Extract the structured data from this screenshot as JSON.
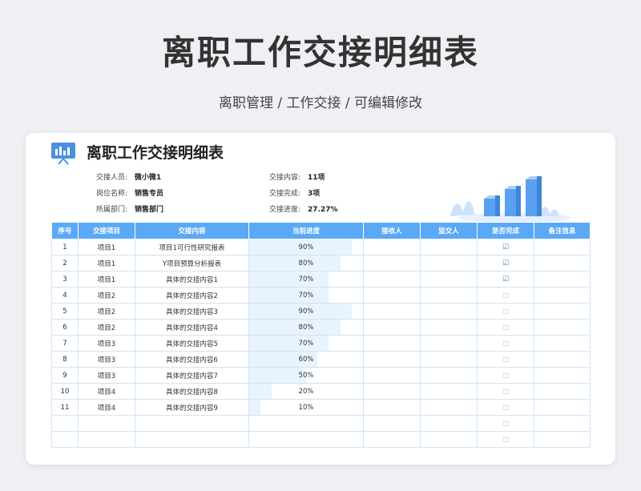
{
  "page": {
    "title": "离职工作交接明细表",
    "subtitle": "离职管理 / 工作交接 / 可编辑修改"
  },
  "doc": {
    "title": "离职工作交接明细表",
    "info_left": [
      {
        "label": "交接人员:",
        "value": "微小微1"
      },
      {
        "label": "岗位名称:",
        "value": "销售专员"
      },
      {
        "label": "所属部门:",
        "value": "销售部门"
      }
    ],
    "info_right": [
      {
        "label": "交接内容:",
        "value": "11项"
      },
      {
        "label": "交接完成:",
        "value": "3项"
      },
      {
        "label": "交接进度:",
        "value": "27.27%"
      }
    ]
  },
  "table": {
    "headers": [
      "序号",
      "交接项目",
      "交接内容",
      "当前进度",
      "接收人",
      "监交人",
      "是否完成",
      "备注信息"
    ],
    "rows": [
      {
        "no": "1",
        "item": "项目1",
        "content": "项目1可行性研究报表",
        "progress": "90%",
        "progress_value": 90,
        "done": true
      },
      {
        "no": "2",
        "item": "项目1",
        "content": "Y项目预算分析报表",
        "progress": "80%",
        "progress_value": 80,
        "done": true
      },
      {
        "no": "3",
        "item": "项目1",
        "content": "具体的交接内容1",
        "progress": "70%",
        "progress_value": 70,
        "done": true
      },
      {
        "no": "4",
        "item": "项目2",
        "content": "具体的交接内容2",
        "progress": "70%",
        "progress_value": 70,
        "done": false
      },
      {
        "no": "5",
        "item": "项目2",
        "content": "具体的交接内容3",
        "progress": "90%",
        "progress_value": 90,
        "done": false
      },
      {
        "no": "6",
        "item": "项目2",
        "content": "具体的交接内容4",
        "progress": "80%",
        "progress_value": 80,
        "done": false
      },
      {
        "no": "7",
        "item": "项目3",
        "content": "具体的交接内容5",
        "progress": "70%",
        "progress_value": 70,
        "done": false
      },
      {
        "no": "8",
        "item": "项目3",
        "content": "具体的交接内容6",
        "progress": "60%",
        "progress_value": 60,
        "done": false
      },
      {
        "no": "9",
        "item": "项目3",
        "content": "具体的交接内容7",
        "progress": "50%",
        "progress_value": 50,
        "done": false
      },
      {
        "no": "10",
        "item": "项目4",
        "content": "具体的交接内容8",
        "progress": "20%",
        "progress_value": 20,
        "done": false
      },
      {
        "no": "11",
        "item": "项目4",
        "content": "具体的交接内容9",
        "progress": "10%",
        "progress_value": 10,
        "done": false
      },
      {
        "no": "",
        "item": "",
        "content": "",
        "progress": "",
        "progress_value": 0,
        "done": false
      },
      {
        "no": "",
        "item": "",
        "content": "",
        "progress": "",
        "progress_value": 0,
        "done": false
      }
    ],
    "check_on": "☑",
    "check_off": "□"
  },
  "icons": {
    "doc": "presentation-board-icon",
    "illustration": "bar-chart-illustration"
  },
  "colors": {
    "accent": "#5aa9f7",
    "progress_fill": "#e9f3fd",
    "border": "#cfe3f7"
  }
}
